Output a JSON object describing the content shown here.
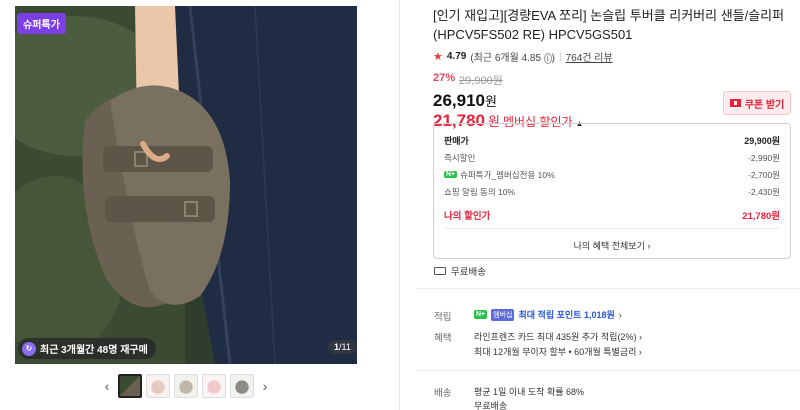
{
  "gallery": {
    "badge": "슈퍼특가",
    "repurchase": "최근 3개월간 48명 재구매",
    "counter_current": "1",
    "counter_total": "/11",
    "prev_arrow": "‹",
    "next_arrow": "›"
  },
  "product": {
    "title": "[인기 재입고][경량EVA 쪼리] 논슬립 투버클 리커버리 샌들/슬리퍼 (HPCV5FS502 RE) HPCV5GS501",
    "rating_score": "4.79",
    "rating_recent": "(최근 6개월 4.85",
    "rating_recent_close": ")",
    "reviews": "764건 리뷰",
    "discount_rate": "27%",
    "original_price": "29,900원",
    "price": "26,910",
    "price_unit": "원",
    "member_price": "21,780",
    "member_unit": "원",
    "member_label": "멤버십 할인가",
    "coupon_button": "쿠폰 받기"
  },
  "breakdown": {
    "rows": [
      {
        "label": "판매가",
        "value": "29,900원"
      },
      {
        "label": "즉시할인",
        "value": "-2,990원"
      },
      {
        "label": "슈퍼특가_멤버십전용 10%",
        "value": "-2,700원",
        "npay": "N+"
      },
      {
        "label": "쇼핑 알림 동의 10%",
        "value": "-2,430원"
      }
    ],
    "my_price_label": "나의 할인가",
    "my_price_value": "21,780원",
    "all_benefits": "나의 혜택 전체보기"
  },
  "shipping": {
    "free": "무료배송"
  },
  "details": {
    "point_label": "적립",
    "point_badge": "N+",
    "point_badge2": "멤버십",
    "point_text": "최대 적립 포인트 1,018원",
    "benefit_label": "혜택",
    "benefit1": "라인프렌즈 카드 최대 435원 추가 적립(2%)",
    "benefit2": "최대 12개월 무이자 할부 • 60개월 특별금리",
    "delivery_label": "배송",
    "delivery1": "평균 1일 이내 도착 확률 68%",
    "delivery2": "무료배송"
  },
  "colors": {
    "accent_red": "#e8223a",
    "super_badge": "#7b3fe4",
    "naver_green": "#2bc04a"
  }
}
